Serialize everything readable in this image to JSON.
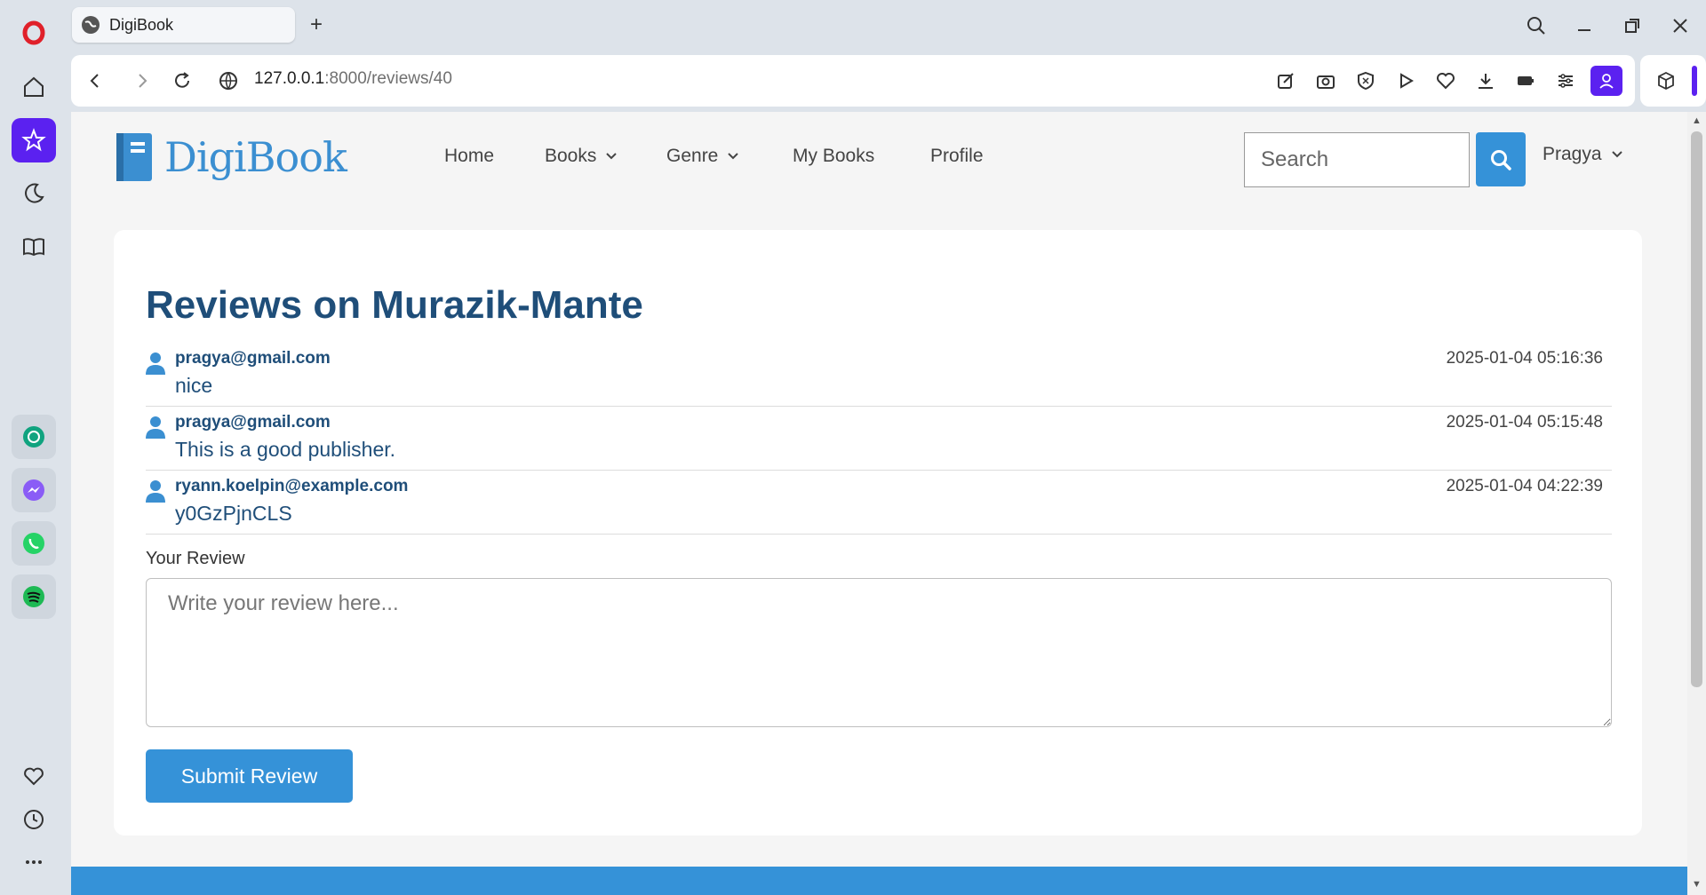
{
  "browser": {
    "tab": {
      "title": "DigiBook"
    },
    "new_tab": "+",
    "url": {
      "host": "127.0.0.1",
      "path": ":8000/reviews/40"
    }
  },
  "site": {
    "brand": "DigiBook",
    "nav": [
      {
        "label": "Home",
        "dropdown": false
      },
      {
        "label": "Books",
        "dropdown": true
      },
      {
        "label": "Genre",
        "dropdown": true
      },
      {
        "label": "My Books",
        "dropdown": false
      },
      {
        "label": "Profile",
        "dropdown": false
      }
    ],
    "search": {
      "placeholder": "Search"
    },
    "user": {
      "name": "Pragya"
    }
  },
  "main": {
    "title": "Reviews on Murazik-Mante",
    "reviews": [
      {
        "email": "pragya@gmail.com",
        "date": "2025-01-04 05:16:36",
        "text": "nice"
      },
      {
        "email": "pragya@gmail.com",
        "date": "2025-01-04 05:15:48",
        "text": "This is a good publisher."
      },
      {
        "email": "ryann.koelpin@example.com",
        "date": "2025-01-04 04:22:39",
        "text": "y0GzPjnCLS"
      }
    ],
    "form": {
      "label": "Your Review",
      "placeholder": "Write your review here...",
      "submit": "Submit Review"
    }
  },
  "colors": {
    "accent": "#3592d8",
    "heading": "#1f4e79",
    "opera_red": "#e0202a",
    "opera_purple": "#5b21f0"
  }
}
